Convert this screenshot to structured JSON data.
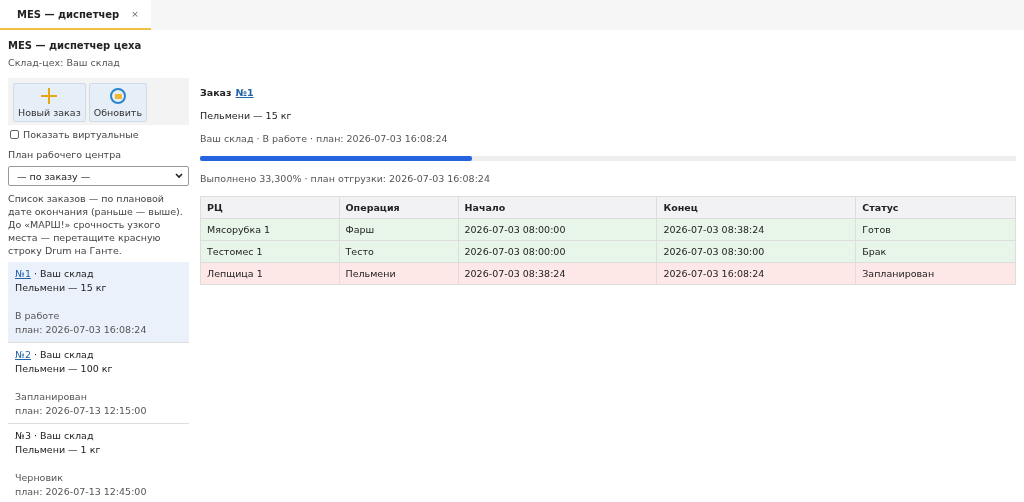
{
  "tabs": [
    {
      "label": "MES — диспетчер",
      "close": "×",
      "selected": true
    }
  ],
  "header": {
    "title": "MES — диспетчер цеха",
    "subtitle": "Склад-цех: Ваш склад"
  },
  "toolbar": [
    {
      "kind": "new",
      "label": "Новый заказ"
    },
    {
      "kind": "refresh",
      "label": "Обновить"
    }
  ],
  "show_virtual": {
    "label": "Показать виртуальные",
    "checked": false
  },
  "plan_select": {
    "label": "План рабочего центра",
    "value": "— по заказу —"
  },
  "hint": "Список заказов — по плановой дате окончания (раньше — выше). До «МАРШ!» срочность узкого места — перетащите красную строку Drum на Ганте.",
  "orders": [
    {
      "number": "№1",
      "link": true,
      "warehouse": "· Ваш склад",
      "product": "Пельмени — 15 кг",
      "status": "В работе",
      "plan": "план: 2026-07-03 16:08:24",
      "selected": true
    },
    {
      "number": "№2",
      "link": true,
      "warehouse": "· Ваш склад",
      "product": "Пельмени — 100 кг",
      "status": "Запланирован",
      "plan": "план: 2026-07-13 12:15:00",
      "selected": false
    },
    {
      "number": "№3",
      "link": false,
      "warehouse": "· Ваш склад",
      "product": "Пельмени — 1 кг",
      "status": "Черновик",
      "plan": "план: 2026-07-13 12:45:00",
      "selected": false
    }
  ],
  "detail": {
    "title": "Заказ",
    "number": "№1",
    "product": "Пельмени — 15 кг",
    "meta": "Ваш склад · В работе · план: 2026-07-03 16:08:24",
    "level": 0.333,
    "progress_text": "Выполнено 33,300% · план отгрузки: 2026-07-03 16:08:24"
  },
  "table": {
    "columns": [
      "РЦ",
      "Операция",
      "Начало",
      "Конец",
      "Статус"
    ],
    "rows": [
      {
        "color": "#e8f5e9",
        "cells": [
          "Мясорубка 1",
          "Фарш",
          "2026-07-03 08:00:00",
          "2026-07-03 08:38:24",
          "Готов"
        ]
      },
      {
        "color": "#e8f5e9",
        "cells": [
          "Тестомес 1",
          "Тесто",
          "2026-07-03 08:00:00",
          "2026-07-03 08:30:00",
          "Брак"
        ]
      },
      {
        "color": "#fde7e7",
        "cells": [
          "Лепщица 1",
          "Пельмени",
          "2026-07-03 08:38:24",
          "2026-07-03 16:08:24",
          "Запланирован"
        ]
      }
    ]
  }
}
